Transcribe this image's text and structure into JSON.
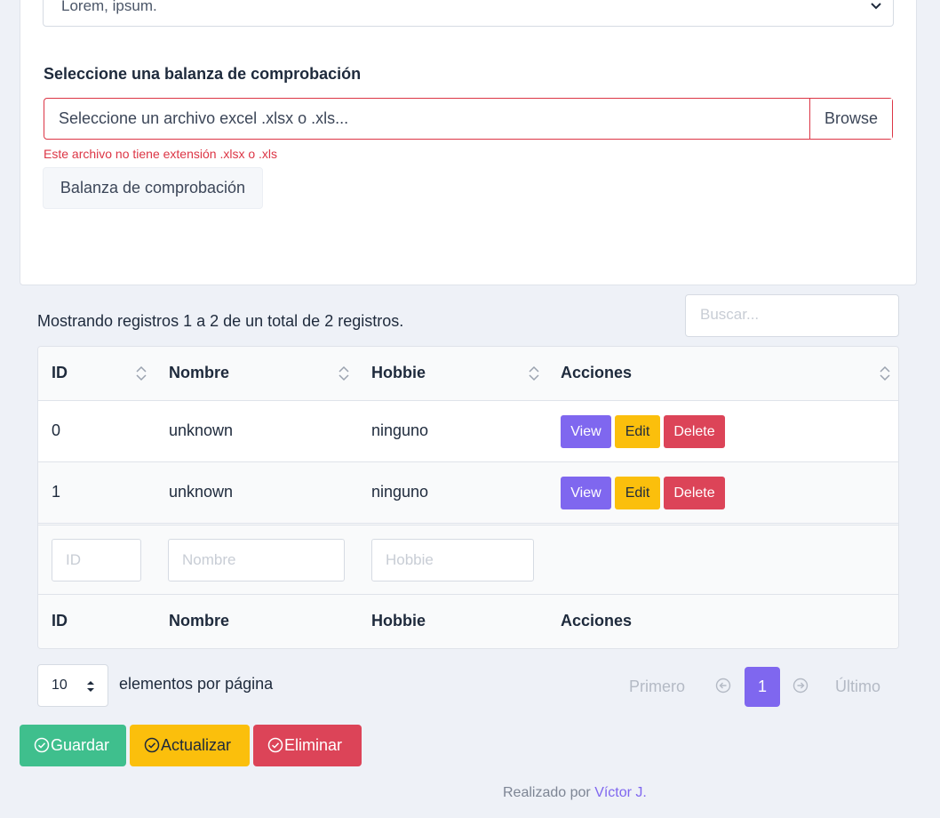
{
  "select": {
    "value": "Lorem, ipsum."
  },
  "file": {
    "label": "Seleccione una balanza de comprobación",
    "placeholder": "Seleccione un archivo excel .xlsx o .xls...",
    "browse": "Browse",
    "error": "Este archivo no tiene extensión .xlsx o .xls",
    "button": "Balanza de comprobación"
  },
  "table": {
    "info": "Mostrando registros 1 a 2 de un total de 2 registros.",
    "search_placeholder": "Buscar...",
    "headers": [
      "ID",
      "Nombre",
      "Hobbie",
      "Acciones"
    ],
    "rows": [
      {
        "id": "0",
        "nombre": "unknown",
        "hobbie": "ninguno"
      },
      {
        "id": "1",
        "nombre": "unknown",
        "hobbie": "ninguno"
      }
    ],
    "actions": {
      "view": "View",
      "edit": "Edit",
      "delete": "Delete"
    },
    "filters": {
      "id": "ID",
      "nombre": "Nombre",
      "hobbie": "Hobbie"
    },
    "footer_headers": [
      "ID",
      "Nombre",
      "Hobbie",
      "Acciones"
    ]
  },
  "pagination": {
    "per_page": "10",
    "per_page_label": "elementos por página",
    "first": "Primero",
    "current": "1",
    "last": "Último"
  },
  "buttons": {
    "guardar": "Guardar",
    "actualizar": "Actualizar",
    "eliminar": "Eliminar"
  },
  "footer": {
    "prefix": "Realizado por",
    "author": "Víctor J."
  },
  "colors": {
    "primary": "#7f67ef",
    "success": "#3fbf8d",
    "warning": "#fbbf0c",
    "danger": "#dc4458"
  }
}
